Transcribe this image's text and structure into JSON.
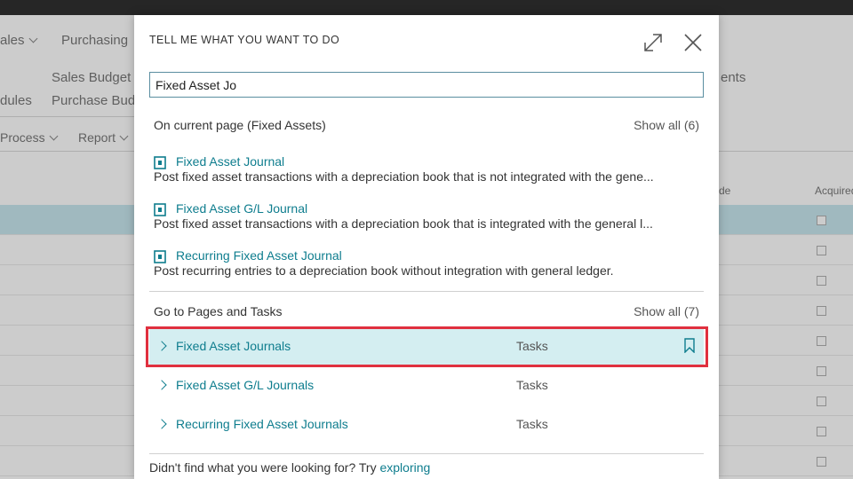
{
  "background": {
    "nav": [
      "ales",
      "Purchasing"
    ],
    "ribbon_row1": [
      "Sales Budget",
      "ents"
    ],
    "ribbon_row2": [
      "dules",
      "Purchase Bud"
    ],
    "actions": [
      "Process",
      "Report"
    ],
    "columns": [
      "de",
      "Acquired"
    ],
    "row_count": 9
  },
  "dialog": {
    "title": "TELL ME WHAT YOU WANT TO DO",
    "expand_icon": "expand-icon",
    "close_icon": "close-icon",
    "search_value": "Fixed Asset Jo",
    "current_page": {
      "heading": "On current page (Fixed Assets)",
      "show_all": "Show all (6)",
      "results": [
        {
          "title": "Fixed Asset Journal",
          "description": "Post fixed asset transactions with a depreciation book that is not integrated with the gene..."
        },
        {
          "title": "Fixed Asset G/L Journal",
          "description": "Post fixed asset transactions with a depreciation book that is integrated with the general l..."
        },
        {
          "title": "Recurring Fixed Asset Journal",
          "description": "Post recurring entries to a depreciation book without integration with general ledger."
        }
      ]
    },
    "pages_tasks": {
      "heading": "Go to Pages and Tasks",
      "show_all": "Show all (7)",
      "items": [
        {
          "name": "Fixed Asset Journals",
          "type": "Tasks"
        },
        {
          "name": "Fixed Asset G/L Journals",
          "type": "Tasks"
        },
        {
          "name": "Recurring Fixed Asset Journals",
          "type": "Tasks"
        }
      ]
    },
    "footer_text": "Didn't find what you were looking for? Try",
    "footer_link": "exploring"
  },
  "colors": {
    "accent": "#0e7d8e",
    "highlight_row": "#d4eef1",
    "annotation": "#e0303f",
    "selected_bg_row": "#b9e1ea"
  }
}
